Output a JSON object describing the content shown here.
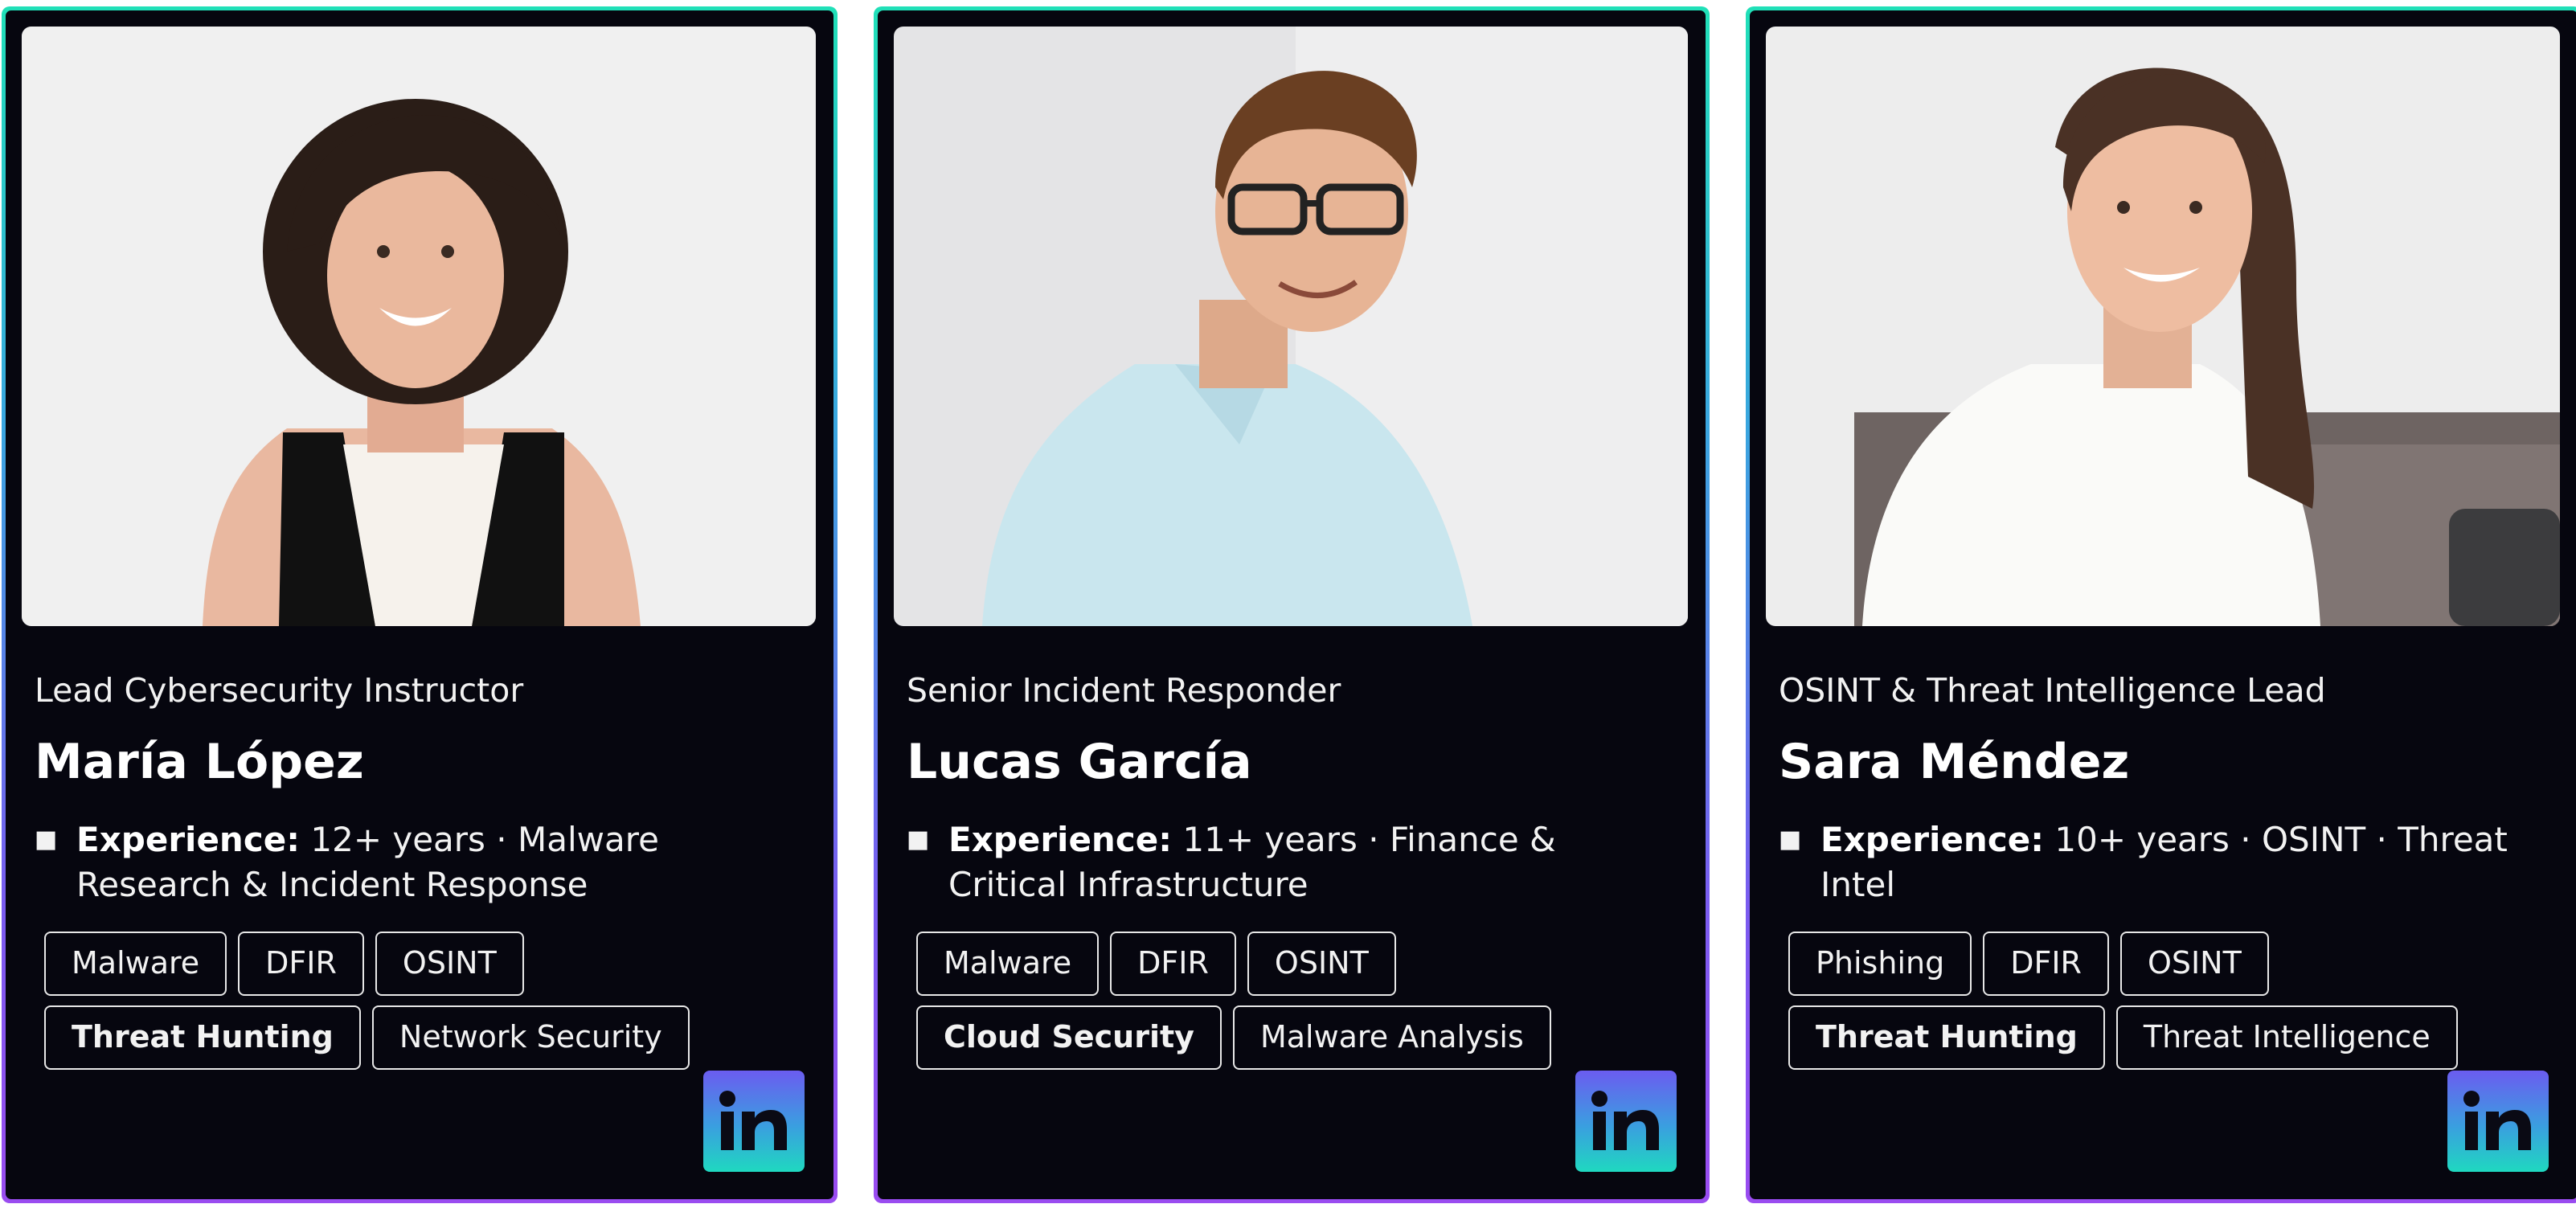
{
  "colors": {
    "card_background": "#06060f",
    "border_gradient_top": "#20e0b8",
    "border_gradient_bottom": "#9a4cf0",
    "tag_border": "#e8e8e8",
    "text": "#f2f2f2"
  },
  "experience_label": "Experience:",
  "instructors": [
    {
      "role": "Lead Cybersecurity Instructor",
      "name": "María López",
      "experience": "12+ years · Malware Research & Incident Response",
      "tags": [
        "Malware",
        "DFIR",
        "OSINT",
        "Threat Hunting",
        "Network Security"
      ],
      "linkedin_icon": "linkedin-icon"
    },
    {
      "role": "Senior Incident Responder",
      "name": "Lucas García",
      "experience": "11+ years · Finance & Critical Infrastructure",
      "tags": [
        "Malware",
        "DFIR",
        "OSINT",
        "Cloud Security",
        "Malware Analysis"
      ],
      "linkedin_icon": "linkedin-icon"
    },
    {
      "role": "OSINT & Threat Intelligence Lead",
      "name": "Sara Méndez",
      "experience": "10+ years · OSINT · Threat Intel",
      "tags": [
        "Phishing",
        "DFIR",
        "OSINT",
        "Threat Hunting",
        "Threat Intelligence"
      ],
      "linkedin_icon": "linkedin-icon"
    }
  ]
}
